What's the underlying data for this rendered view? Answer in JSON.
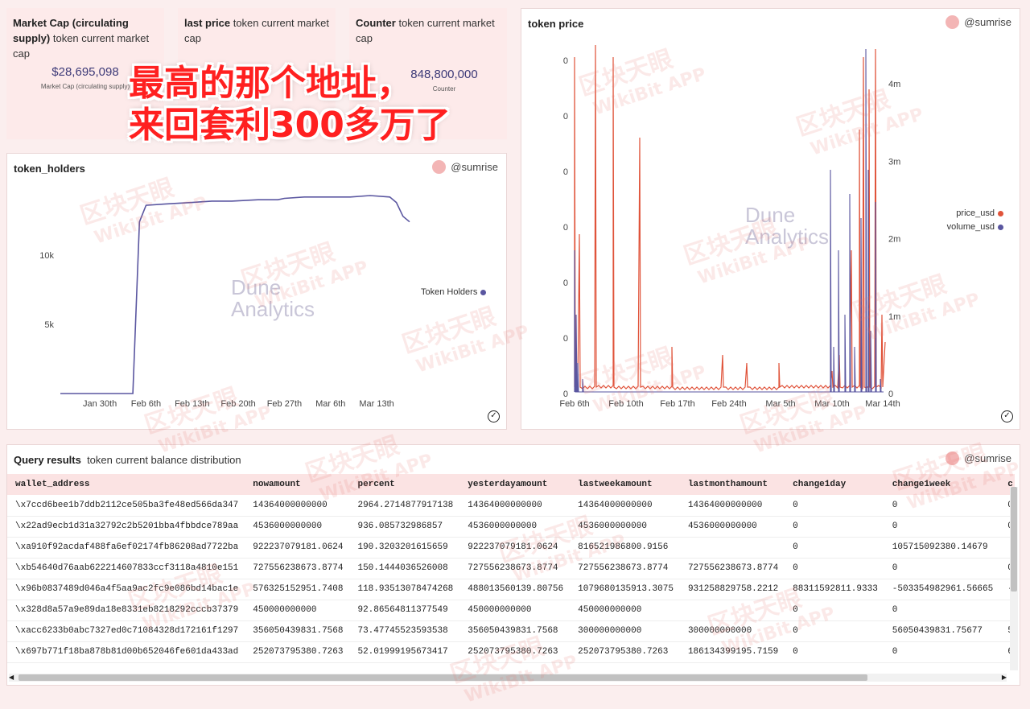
{
  "kpis": [
    {
      "title": "Market Cap (circulating supply)",
      "subtitle": "token current market cap",
      "value": "$28,695,098",
      "caption": "Market Cap (circulating supply)"
    },
    {
      "title": "last price",
      "subtitle": "token current market cap",
      "value": "$0.",
      "caption": ""
    },
    {
      "title": "Counter",
      "subtitle": "token current market cap",
      "value": "848,800,000",
      "caption": "Counter"
    }
  ],
  "holders_chart": {
    "title": "token_holders",
    "author": "@sumrise",
    "logo_line1": "Dune",
    "logo_line2": "Analytics",
    "legend": "Token Holders",
    "series_color": "#5a56a0",
    "chart_data": {
      "type": "line",
      "title": "token_holders",
      "xlabel": "",
      "ylabel": "",
      "x_ticks": [
        "Jan 30th",
        "Feb 6th",
        "Feb 13th",
        "Feb 20th",
        "Feb 27th",
        "Mar 6th",
        "Mar 13th"
      ],
      "y_ticks": [
        "5k",
        "10k"
      ],
      "ylim": [
        0,
        15000
      ],
      "series": [
        {
          "name": "Token Holders",
          "x": [
            -6,
            -3,
            0,
            3,
            5,
            6,
            7,
            10,
            14,
            17,
            20,
            24,
            27,
            28,
            31,
            34,
            38,
            41,
            44,
            45,
            46,
            47
          ],
          "values": [
            0,
            0,
            0,
            0,
            0,
            12400,
            13600,
            13700,
            13800,
            13900,
            13900,
            14000,
            14000,
            14100,
            14200,
            14200,
            14200,
            14300,
            14200,
            13800,
            12800,
            12400
          ]
        }
      ]
    }
  },
  "price_chart": {
    "title": "token price",
    "author": "@sumrise",
    "logo_line1": "Dune",
    "logo_line2": "Analytics",
    "legend": [
      {
        "label": "price_usd",
        "color": "#e0533a"
      },
      {
        "label": "volume_usd",
        "color": "#5a56a0"
      }
    ],
    "chart_data": {
      "type": "line",
      "title": "token price",
      "x_ticks": [
        "Feb 6th",
        "Feb 10th",
        "Feb 17th",
        "Feb 24th",
        "Mar 5th",
        "Mar 10th",
        "Mar 14th"
      ],
      "y_left_ticks": [
        "0",
        "0",
        "0",
        "0",
        "0",
        "0",
        "0"
      ],
      "y_right_ticks": [
        "0",
        "1m",
        "2m",
        "3m",
        "4m"
      ],
      "ylim_right": [
        0,
        4500000
      ],
      "series": [
        {
          "name": "price_usd",
          "color": "#e0533a"
        },
        {
          "name": "volume_usd",
          "color": "#5a56a0"
        }
      ]
    }
  },
  "query": {
    "title": "Query results",
    "subtitle": "token current balance distribution",
    "author": "@sumrise",
    "columns": [
      "wallet_address",
      "nowamount",
      "percent",
      "yesterdayamount",
      "lastweekamount",
      "lastmonthamount",
      "change1day",
      "change1week",
      "c"
    ],
    "rows": [
      [
        "\\x7ccd6bee1b7ddb2112ce505ba3fe48ed566da347",
        "14364000000000",
        "2964.2714877917138",
        "14364000000000",
        "14364000000000",
        "14364000000000",
        "0",
        "0",
        "0"
      ],
      [
        "\\x22ad9ecb1d31a32792c2b5201bba4fbbdce789aa",
        "4536000000000",
        "936.085732986857",
        "4536000000000",
        "4536000000000",
        "4536000000000",
        "0",
        "0",
        "0"
      ],
      [
        "\\xa910f92acdaf488fa6ef02174fb86208ad7722ba",
        "922237079181.0624",
        "190.3203201615659",
        "922237079181.0624",
        "816521986800.9156",
        "",
        "0",
        "105715092380.14679",
        ""
      ],
      [
        "\\xb54640d76aab622214607833ccf3118a4810e151",
        "727556238673.8774",
        "150.1444036526008",
        "727556238673.8774",
        "727556238673.8774",
        "727556238673.8774",
        "0",
        "0",
        "0"
      ],
      [
        "\\x96b0837489d046a4f5aa9ac2fc9e086bd14bac1e",
        "576325152951.7408",
        "118.93513078474268",
        "488013560139.80756",
        "1079680135913.3075",
        "931258829758.2212",
        "88311592811.9333",
        "-503354982961.56665",
        "-"
      ],
      [
        "\\x328d8a57a9e89da18e8331eb8218292cccb37379",
        "450000000000",
        "92.86564811377549",
        "450000000000",
        "450000000000",
        "",
        "0",
        "0",
        ""
      ],
      [
        "\\xacc6233b0abc7327ed0c71084328d172161f1297",
        "356050439831.7568",
        "73.47745523593538",
        "356050439831.7568",
        "300000000000",
        "300000000000",
        "0",
        "56050439831.75677",
        "5"
      ],
      [
        "\\x697b771f18ba878b81d00b652046fe601da433ad",
        "252073795380.7263",
        "52.01999195673417",
        "252073795380.7263",
        "252073795380.7263",
        "186134399195.7159",
        "0",
        "0",
        "6"
      ]
    ]
  },
  "overlay": {
    "line1": "最高的那个地址，",
    "line2": "来回套利300多万了"
  },
  "watermark": {
    "cn": "区块天眼",
    "en": "WikiBit APP"
  }
}
